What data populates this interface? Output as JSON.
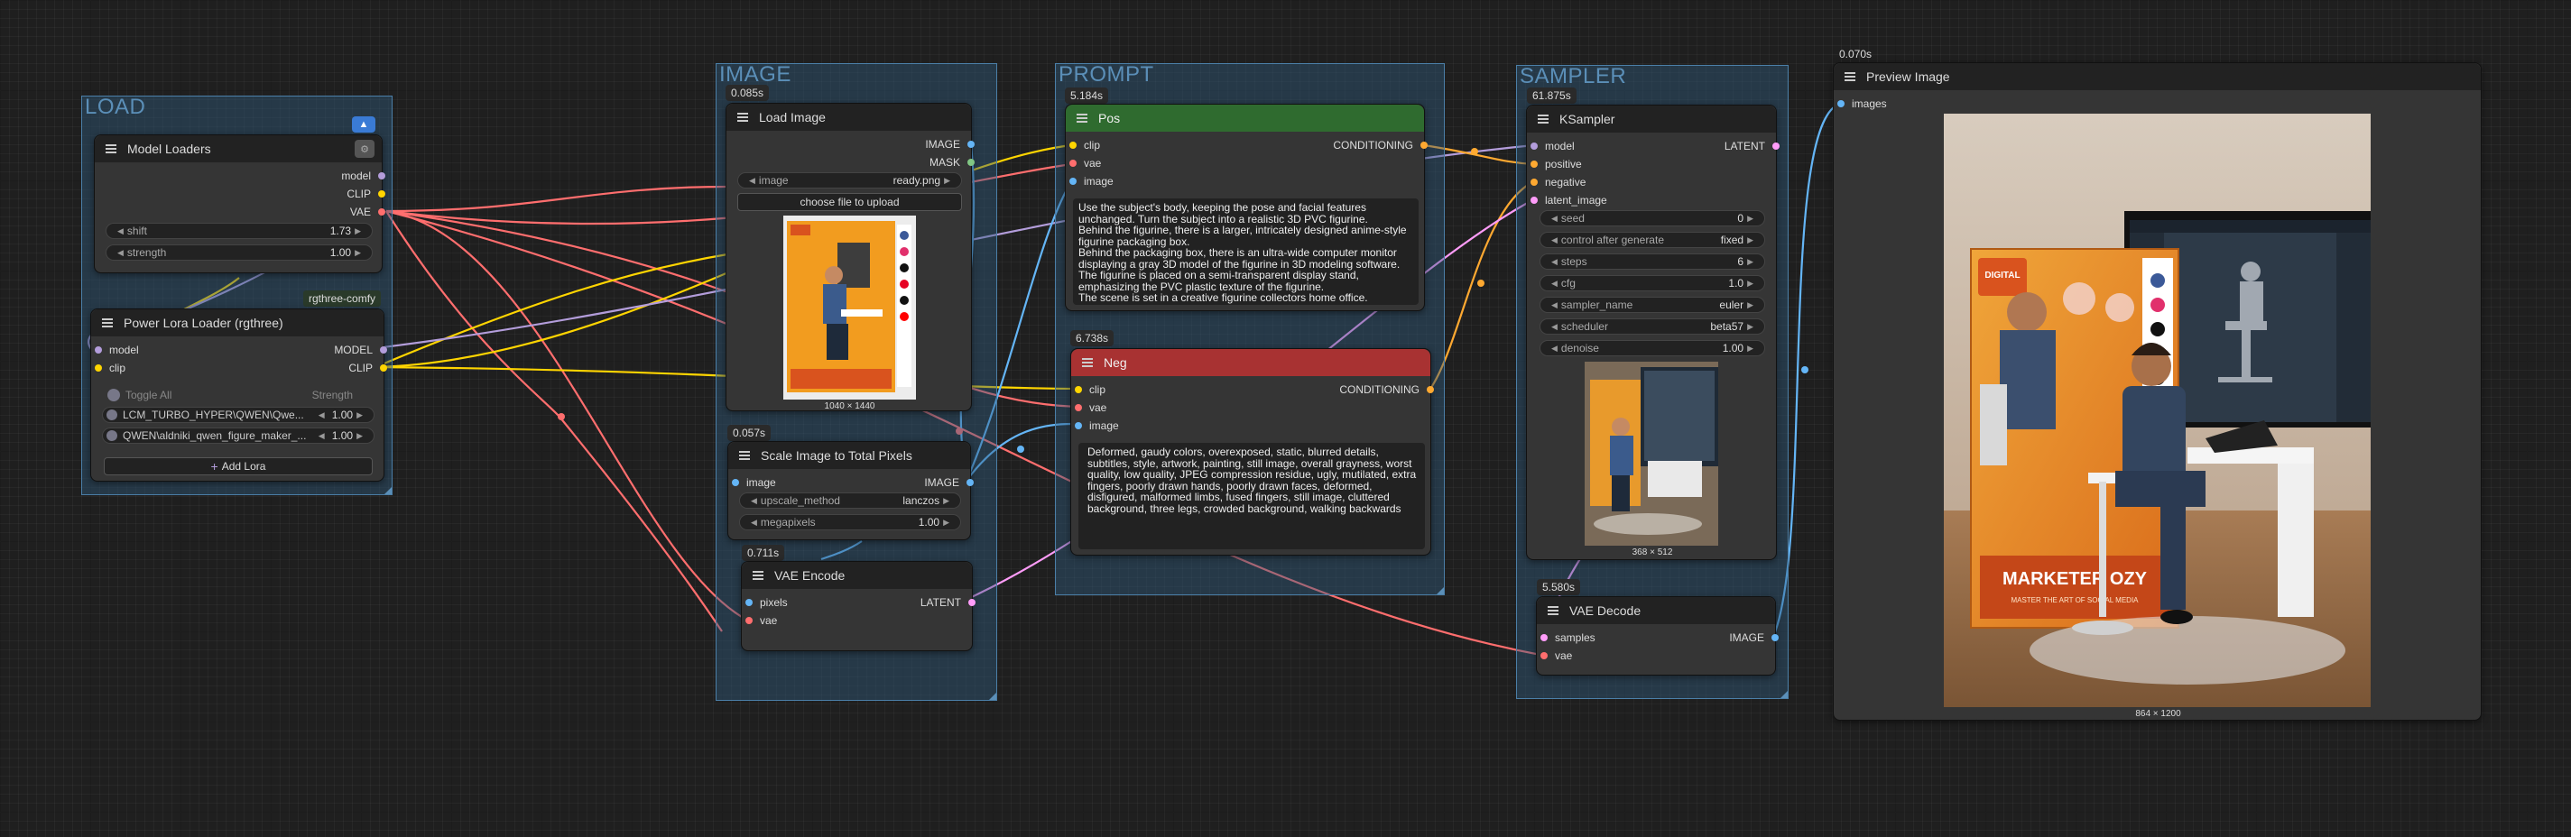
{
  "colors": {
    "model": "#b39ddb",
    "clip": "#ffd500",
    "vae": "#ff6e6e",
    "image": "#64b5f6",
    "mask": "#81c784",
    "conditioning": "#ffa931",
    "latent": "#ff9cf9"
  },
  "groups": {
    "load": "LOAD",
    "image": "IMAGE",
    "prompt": "PROMPT",
    "sampler": "SAMPLER"
  },
  "model_loaders": {
    "title": "Model Loaders",
    "outputs": [
      "model",
      "CLIP",
      "VAE"
    ],
    "widgets": [
      {
        "label": "shift",
        "value": "1.73"
      },
      {
        "label": "strength",
        "value": "1.00"
      }
    ]
  },
  "rgthree_badge": "rgthree-comfy",
  "power_lora": {
    "title": "Power Lora Loader (rgthree)",
    "inputs": [
      "model",
      "clip"
    ],
    "outputs": [
      "MODEL",
      "CLIP"
    ],
    "toggle_all": "Toggle All",
    "strength_header": "Strength",
    "loras": [
      {
        "name": "LCM_TURBO_HYPER\\QWEN\\Qwe...",
        "strength": "1.00"
      },
      {
        "name": "QWEN\\aldniki_qwen_figure_maker_...",
        "strength": "1.00"
      }
    ],
    "add_lora": "Add Lora"
  },
  "load_image": {
    "time": "0.085s",
    "title": "Load Image",
    "outputs": [
      "IMAGE",
      "MASK"
    ],
    "image_widget": {
      "label": "image",
      "value": "ready.png"
    },
    "upload_button": "choose file to upload",
    "dimensions": "1040 × 1440"
  },
  "scale_image": {
    "time": "0.057s",
    "title": "Scale Image to Total Pixels",
    "input": "image",
    "output": "IMAGE",
    "widgets": [
      {
        "label": "upscale_method",
        "value": "lanczos"
      },
      {
        "label": "megapixels",
        "value": "1.00"
      }
    ]
  },
  "vae_encode": {
    "time": "0.711s",
    "title": "VAE Encode",
    "inputs": [
      "pixels",
      "vae"
    ],
    "output": "LATENT"
  },
  "pos": {
    "time": "5.184s",
    "title": "Pos",
    "inputs": [
      "clip",
      "vae",
      "image"
    ],
    "output": "CONDITIONING",
    "text": "Use the subject's body, keeping the pose and facial features unchanged. Turn the subject into a realistic 3D PVC figurine.\nBehind the figurine, there is a larger, intricately designed anime-style figurine packaging box.\nBehind the packaging box, there is an ultra-wide computer monitor displaying a gray 3D model of the figurine in 3D modeling software.\nThe figurine is placed on a semi-transparent display stand, emphasizing the PVC plastic texture of the figurine.\nThe scene is set in a creative figurine collectors home office."
  },
  "neg": {
    "time": "6.738s",
    "title": "Neg",
    "inputs": [
      "clip",
      "vae",
      "image"
    ],
    "output": "CONDITIONING",
    "text": "Deformed, gaudy colors, overexposed, static, blurred details, subtitles, style, artwork, painting, still image, overall grayness, worst quality, low quality, JPEG compression residue, ugly, mutilated, extra fingers, poorly drawn hands, poorly drawn faces, deformed, disfigured, malformed limbs, fused fingers, still image, cluttered background, three legs, crowded background, walking backwards"
  },
  "ksampler": {
    "time": "61.875s",
    "title": "KSampler",
    "inputs": [
      "model",
      "positive",
      "negative",
      "latent_image"
    ],
    "output": "LATENT",
    "widgets": [
      {
        "label": "seed",
        "value": "0"
      },
      {
        "label": "control after generate",
        "value": "fixed"
      },
      {
        "label": "steps",
        "value": "6"
      },
      {
        "label": "cfg",
        "value": "1.0"
      },
      {
        "label": "sampler_name",
        "value": "euler"
      },
      {
        "label": "scheduler",
        "value": "beta57"
      },
      {
        "label": "denoise",
        "value": "1.00"
      }
    ],
    "dimensions": "368 × 512"
  },
  "vae_decode": {
    "time": "5.580s",
    "title": "VAE Decode",
    "inputs": [
      "samples",
      "vae"
    ],
    "output": "IMAGE"
  },
  "preview": {
    "time": "0.070s",
    "title": "Preview Image",
    "input": "images",
    "dimensions": "864 × 1200",
    "box_brand": "DIGITAL\nMARKETER",
    "box_title": "MARKETER OZY",
    "box_sub": "MASTER THE ART OF SOCIAL MEDIA"
  },
  "input_image": {
    "title": "DIGITAL MARKETER OZY"
  }
}
